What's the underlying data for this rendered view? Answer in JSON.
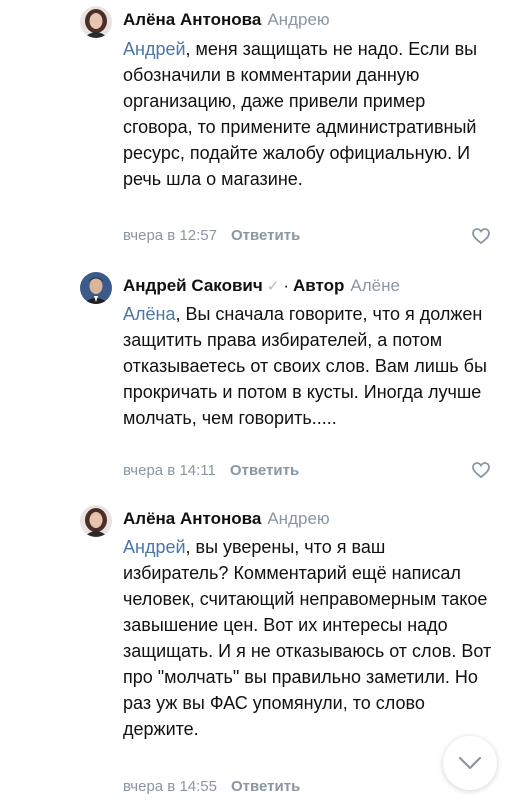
{
  "comments": [
    {
      "author": "Алёна Антонова",
      "reply_to": "Андрею",
      "mention": "Андрей",
      "text": ", меня защищать не надо. Если вы обозначили в комментарии данную организацию, даже привели пример сговора, то примените административный ресурс, подайте жалобу официальную. И речь шла о магазине.",
      "time": "вчера в 12:57",
      "reply_label": "Ответить"
    },
    {
      "author": "Андрей Сакович",
      "verified": "✓",
      "role": "Автор",
      "reply_to": "Алёне",
      "mention": "Алёна",
      "text": ", Вы сначала говорите, что я должен защитить права избирателей, а потом отказываетесь от своих слов. Вам лишь бы прокричать и потом в кусты. Иногда лучше молчать, чем говорить.....",
      "time": "вчера в 14:11",
      "reply_label": "Ответить"
    },
    {
      "author": "Алёна Антонова",
      "reply_to": "Андрею",
      "mention": "Андрей",
      "text": ", вы уверены, что я ваш избиратель? Комментарий ещё написал человек, считающий неправомерным такое завышение цен. Вот их интересы надо защищать. И я не отказываюсь от слов. Вот про \"молчать\" вы правильно заметили. Но раз уж вы ФАС упомянули, то слово держите.",
      "time": "вчера в 14:55",
      "reply_label": "Ответить"
    }
  ],
  "colors": {
    "link": "#4a76a8",
    "secondary": "#8a96a3"
  },
  "icons": {
    "like": "heart-outline-icon",
    "scroll": "chevron-down-icon"
  }
}
